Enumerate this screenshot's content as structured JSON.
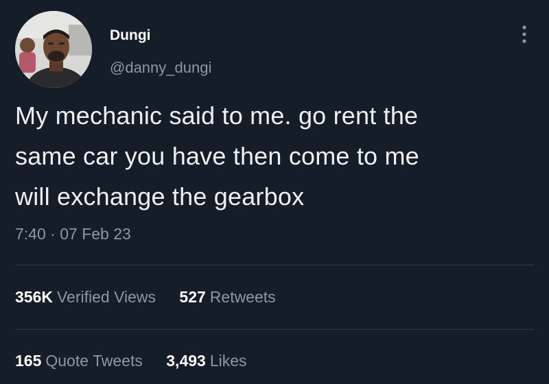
{
  "user": {
    "display_name": "Dungi",
    "handle": "@danny_dungi"
  },
  "tweet": {
    "lines": [
      "My mechanic said to me. go rent the",
      "same car you have then come to me",
      "will exchange the gearbox"
    ],
    "time": "7:40",
    "separator": "·",
    "date": "07 Feb 23"
  },
  "stats": {
    "views_count": "356K",
    "views_label": "Verified Views",
    "retweets_count": "527",
    "retweets_label": "Retweets",
    "quotes_count": "165",
    "quotes_label": "Quote Tweets",
    "likes_count": "3,493",
    "likes_label": "Likes"
  },
  "icons": {
    "more": "more-vertical-icon"
  },
  "colors": {
    "background": "#151d28",
    "primary_text": "#eef0f2",
    "secondary_text": "#8b98a5",
    "divider": "#2f3b47"
  }
}
